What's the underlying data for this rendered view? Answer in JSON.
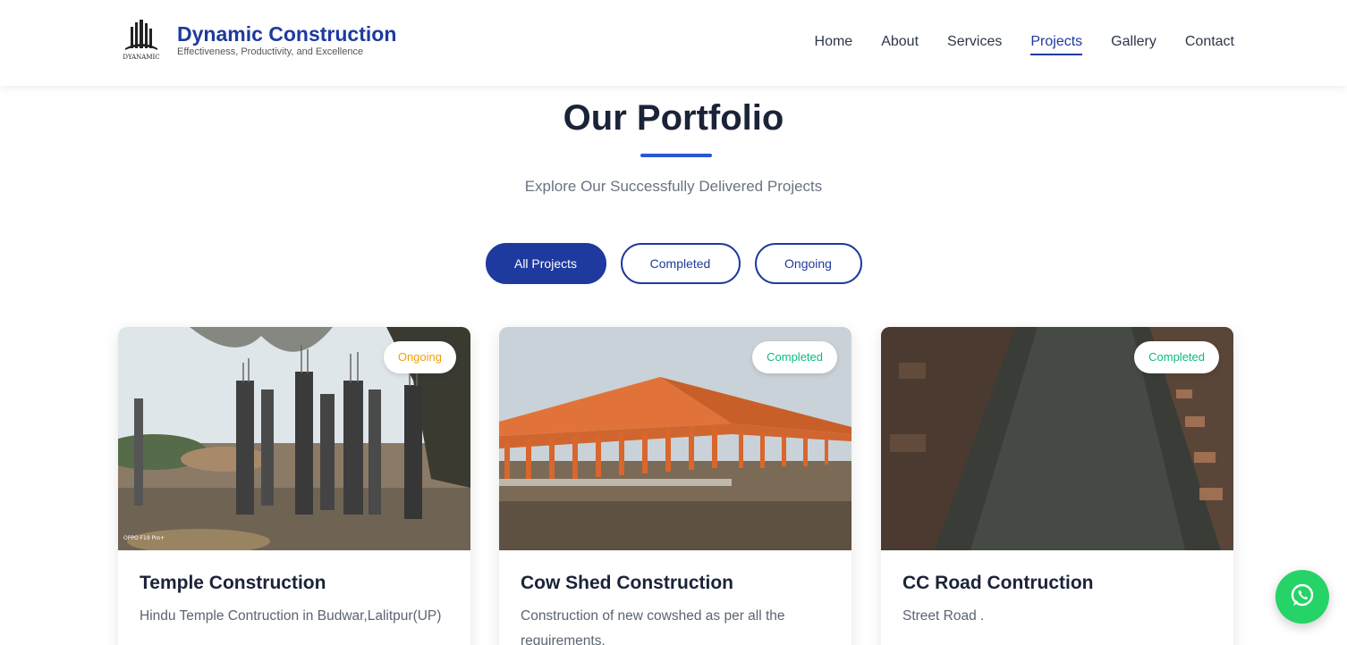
{
  "brand": {
    "title": "Dynamic Construction",
    "tagline": "Effectiveness, Productivity, and Excellence",
    "logo_text": "DYANAMIC"
  },
  "nav": [
    {
      "label": "Home",
      "active": false
    },
    {
      "label": "About",
      "active": false
    },
    {
      "label": "Services",
      "active": false
    },
    {
      "label": "Projects",
      "active": true
    },
    {
      "label": "Gallery",
      "active": false
    },
    {
      "label": "Contact",
      "active": false
    }
  ],
  "section": {
    "title": "Our Portfolio",
    "subtitle": "Explore Our Successfully Delivered Projects"
  },
  "filters": {
    "all": "All Projects",
    "completed": "Completed",
    "ongoing": "Ongoing",
    "selected": "All Projects"
  },
  "projects": [
    {
      "title": "Temple Construction",
      "description": "Hindu Temple Contruction in Budwar,Lalitpur(UP)",
      "status": "Ongoing",
      "photo_watermark": "OPPO F19 Pro+"
    },
    {
      "title": "Cow Shed Construction",
      "description": "Construction of new cowshed as per all the requirements.",
      "status": "Completed"
    },
    {
      "title": "CC Road Contruction",
      "description": "Street Road .",
      "status": "Completed"
    }
  ],
  "colors": {
    "primary": "#1e3a9e",
    "accent_bar": "#2a56d6",
    "ongoing": "#f59e0b",
    "completed": "#10b981",
    "whatsapp": "#25d366"
  },
  "icons": {
    "whatsapp": "whatsapp-icon"
  }
}
